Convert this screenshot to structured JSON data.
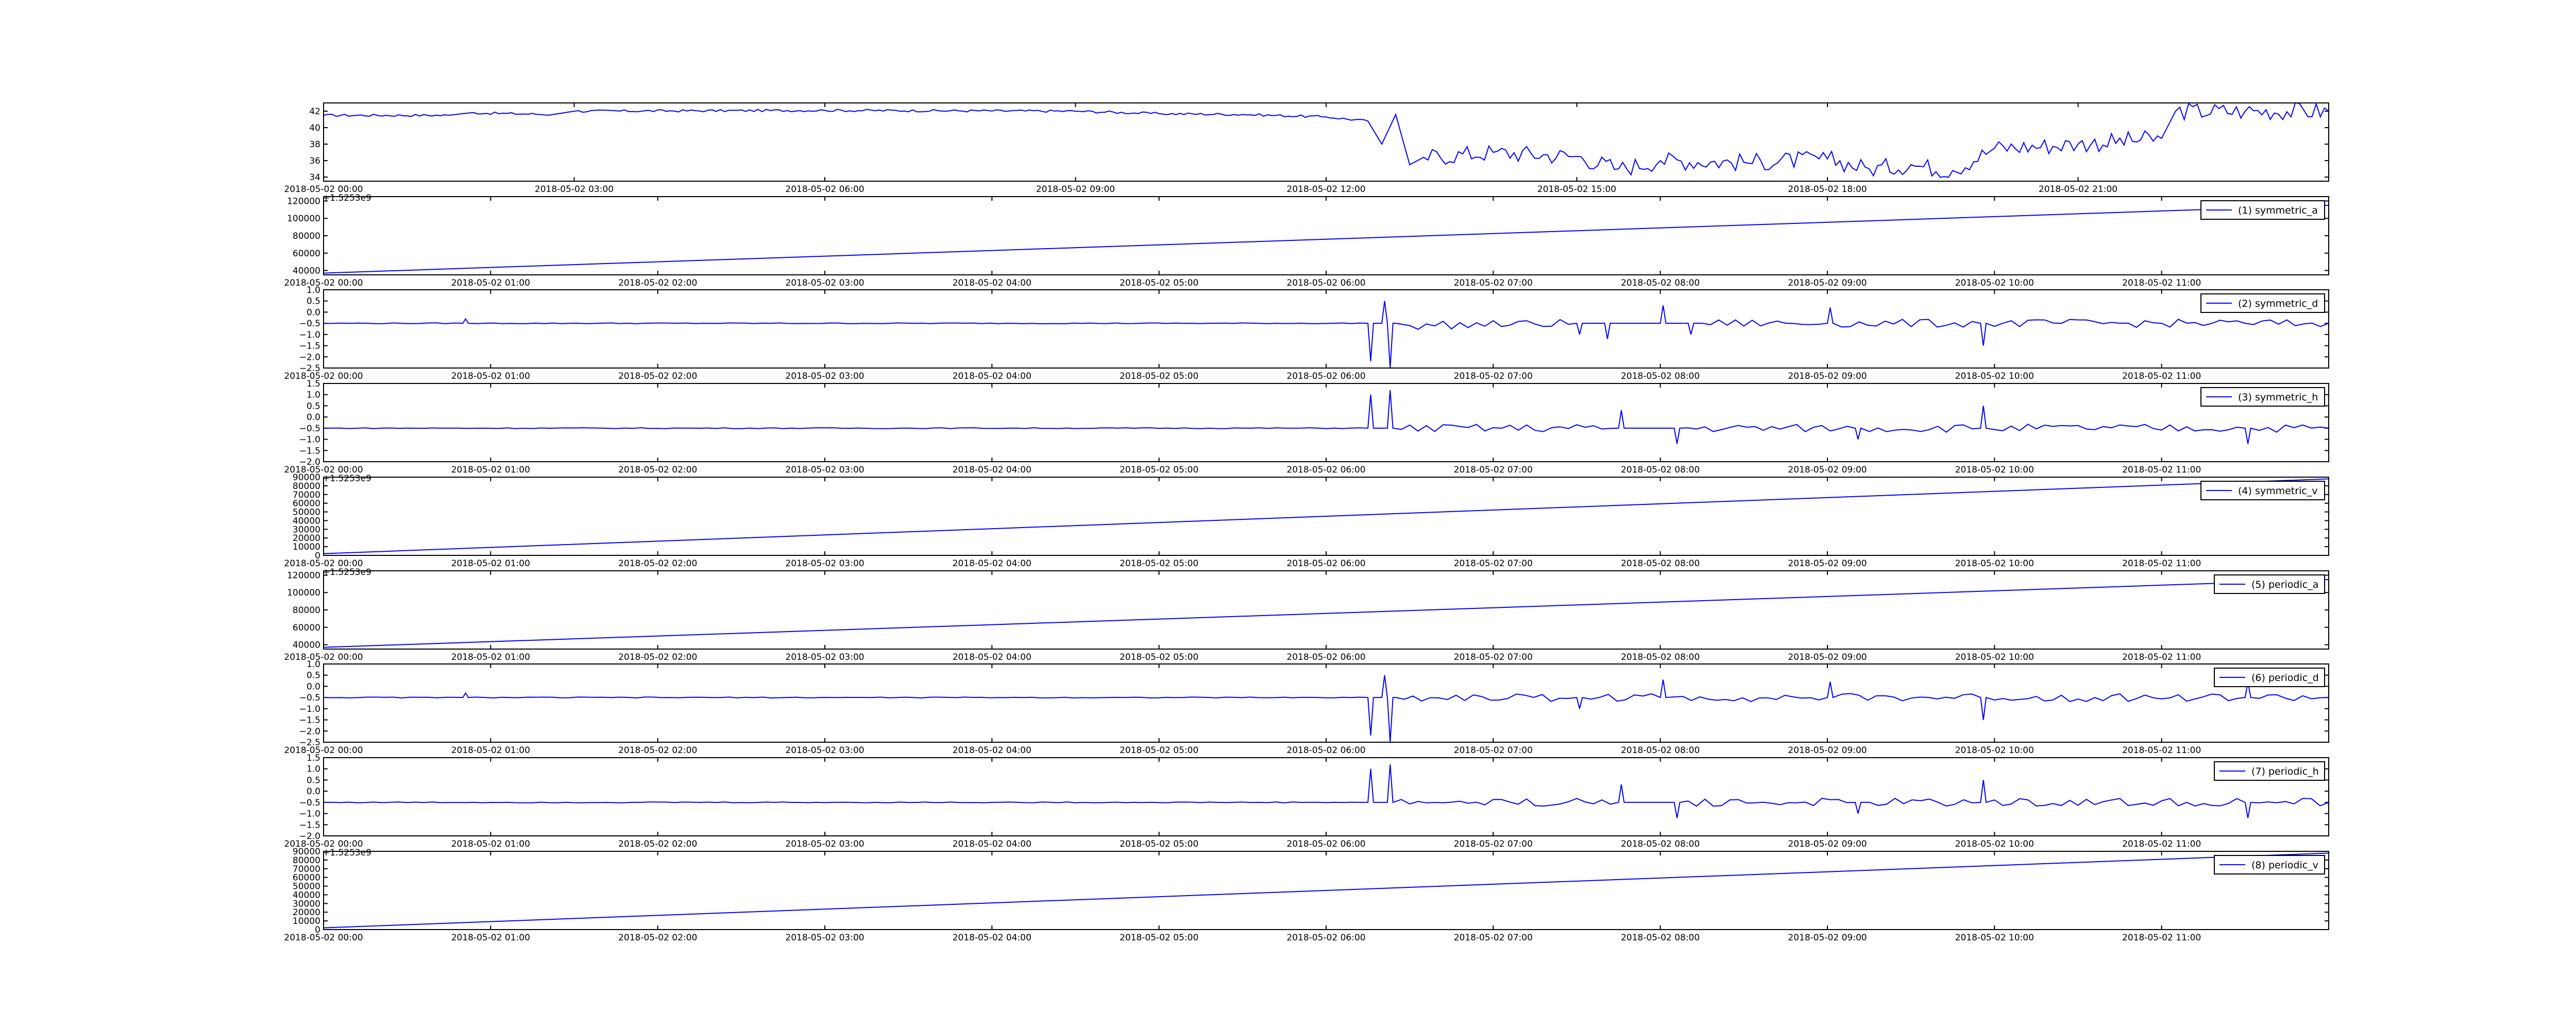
{
  "chart_data": [
    {
      "type": "line",
      "title": "",
      "ylim": [
        33.5,
        43
      ],
      "yticks": [
        34,
        36,
        38,
        40,
        42
      ],
      "yticklabels": [
        "34",
        "36",
        "38",
        "40",
        "42"
      ],
      "xlim": [
        "2018-05-02 00:00",
        "2018-05-03 00:00"
      ],
      "xticklabels": [
        "2018-05-02 00:00",
        "2018-05-02 03:00",
        "2018-05-02 06:00",
        "2018-05-02 09:00",
        "2018-05-02 12:00",
        "2018-05-02 15:00",
        "2018-05-02 18:00",
        "2018-05-02 21:00"
      ],
      "offset_text": "+1.5253e9",
      "series": [
        {
          "x": [
            "2018-05-02 00:00",
            "2018-05-02 01:30",
            "2018-05-02 01:45",
            "2018-05-02 02:45",
            "2018-05-02 03:00",
            "2018-05-02 06:00",
            "2018-05-02 09:00",
            "2018-05-02 10:00",
            "2018-05-02 11:00",
            "2018-05-02 12:00",
            "2018-05-02 12:30",
            "2018-05-02 12:40",
            "2018-05-02 12:50",
            "2018-05-02 13:00",
            "2018-05-02 13:10",
            "2018-05-02 14:00",
            "2018-05-02 15:00",
            "2018-05-02 15:30",
            "2018-05-02 16:00",
            "2018-05-02 17:00",
            "2018-05-02 18:00",
            "2018-05-02 18:30",
            "2018-05-02 19:00",
            "2018-05-02 19:30",
            "2018-05-02 20:00",
            "2018-05-02 21:00",
            "2018-05-02 22:00",
            "2018-05-02 22:10",
            "2018-05-02 23:00",
            "2018-05-03 00:00"
          ],
          "values": [
            41.5,
            41.5,
            41.8,
            41.6,
            42.0,
            42.1,
            42.0,
            41.7,
            41.6,
            41.3,
            40.8,
            38.0,
            41.6,
            35.5,
            36.4,
            37.0,
            36.5,
            35.0,
            36.0,
            35.8,
            36.2,
            35.0,
            35.5,
            34.8,
            37.5,
            38.0,
            38.7,
            42.0,
            42.0,
            42.0
          ]
        }
      ]
    },
    {
      "type": "line",
      "ylim": [
        35000,
        125000
      ],
      "yticks": [
        40000,
        60000,
        80000,
        100000,
        120000
      ],
      "yticklabels": [
        "40000",
        "60000",
        "80000",
        "100000",
        "120000"
      ],
      "xlim": [
        "2018-05-02 00:00",
        "2018-05-02 12:00"
      ],
      "xticklabels": [
        "2018-05-02 00:00",
        "2018-05-02 01:00",
        "2018-05-02 02:00",
        "2018-05-02 03:00",
        "2018-05-02 04:00",
        "2018-05-02 05:00",
        "2018-05-02 06:00",
        "2018-05-02 07:00",
        "2018-05-02 08:00",
        "2018-05-02 09:00",
        "2018-05-02 10:00",
        "2018-05-02 11:00"
      ],
      "offset_text": "",
      "series": [
        {
          "name": "(1) symmetric_a",
          "x": [
            "2018-05-02 00:00",
            "2018-05-02 12:00"
          ],
          "values": [
            37000,
            115000
          ]
        }
      ]
    },
    {
      "type": "line",
      "ylim": [
        -2.5,
        1.0
      ],
      "yticks": [
        -2.5,
        -2.0,
        -1.5,
        -1.0,
        -0.5,
        0.0,
        0.5,
        1.0
      ],
      "yticklabels": [
        "−2.5",
        "−2.0",
        "−1.5",
        "−1.0",
        "−0.5",
        "0.0",
        "0.5",
        "1.0"
      ],
      "xlim": [
        "2018-05-02 00:00",
        "2018-05-02 12:00"
      ],
      "xticklabels": [
        "2018-05-02 00:00",
        "2018-05-02 01:00",
        "2018-05-02 02:00",
        "2018-05-02 03:00",
        "2018-05-02 04:00",
        "2018-05-02 05:00",
        "2018-05-02 06:00",
        "2018-05-02 07:00",
        "2018-05-02 08:00",
        "2018-05-02 09:00",
        "2018-05-02 10:00",
        "2018-05-02 11:00"
      ],
      "offset_text": "",
      "baseline": -0.5,
      "series": [
        {
          "name": "(2) symmetric_d",
          "x": [
            "2018-05-02 00:00",
            "2018-05-02 00:50",
            "2018-05-02 00:51",
            "2018-05-02 00:52",
            "2018-05-02 06:15",
            "2018-05-02 06:16",
            "2018-05-02 06:17",
            "2018-05-02 06:20",
            "2018-05-02 06:21",
            "2018-05-02 06:22",
            "2018-05-02 06:23",
            "2018-05-02 06:24",
            "2018-05-02 06:25",
            "2018-05-02 06:30",
            "2018-05-02 07:30",
            "2018-05-02 07:31",
            "2018-05-02 07:32",
            "2018-05-02 07:40",
            "2018-05-02 07:41",
            "2018-05-02 07:42",
            "2018-05-02 08:00",
            "2018-05-02 08:01",
            "2018-05-02 08:02",
            "2018-05-02 08:10",
            "2018-05-02 08:11",
            "2018-05-02 08:12",
            "2018-05-02 09:00",
            "2018-05-02 09:01",
            "2018-05-02 09:02",
            "2018-05-02 09:55",
            "2018-05-02 09:56",
            "2018-05-02 09:57",
            "2018-05-02 11:30",
            "2018-05-02 12:00"
          ],
          "values": [
            -0.5,
            -0.5,
            -0.3,
            -0.5,
            -0.5,
            -2.2,
            -0.5,
            -0.5,
            0.5,
            -0.5,
            -2.5,
            -0.5,
            -0.5,
            -0.6,
            -0.5,
            -1.0,
            -0.5,
            -0.5,
            -1.2,
            -0.5,
            -0.5,
            0.3,
            -0.5,
            -0.5,
            -1.0,
            -0.5,
            -0.5,
            0.2,
            -0.5,
            -0.5,
            -1.5,
            -0.5,
            -0.5,
            -0.5
          ]
        }
      ]
    },
    {
      "type": "line",
      "ylim": [
        -2.0,
        1.5
      ],
      "yticks": [
        -2.0,
        -1.5,
        -1.0,
        -0.5,
        0.0,
        0.5,
        1.0,
        1.5
      ],
      "yticklabels": [
        "−2.0",
        "−1.5",
        "−1.0",
        "−0.5",
        "0.0",
        "0.5",
        "1.0",
        "1.5"
      ],
      "xlim": [
        "2018-05-02 00:00",
        "2018-05-02 12:00"
      ],
      "xticklabels": [
        "2018-05-02 00:00",
        "2018-05-02 01:00",
        "2018-05-02 02:00",
        "2018-05-02 03:00",
        "2018-05-02 04:00",
        "2018-05-02 05:00",
        "2018-05-02 06:00",
        "2018-05-02 07:00",
        "2018-05-02 08:00",
        "2018-05-02 09:00",
        "2018-05-02 10:00",
        "2018-05-02 11:00"
      ],
      "offset_text": "+1.5253e9",
      "baseline": -0.5,
      "series": [
        {
          "name": "(3) symmetric_h",
          "x": [
            "2018-05-02 00:00",
            "2018-05-02 06:15",
            "2018-05-02 06:16",
            "2018-05-02 06:17",
            "2018-05-02 06:22",
            "2018-05-02 06:23",
            "2018-05-02 06:24",
            "2018-05-02 07:45",
            "2018-05-02 07:46",
            "2018-05-02 07:47",
            "2018-05-02 08:05",
            "2018-05-02 08:06",
            "2018-05-02 08:07",
            "2018-05-02 09:10",
            "2018-05-02 09:11",
            "2018-05-02 09:12",
            "2018-05-02 09:55",
            "2018-05-02 09:56",
            "2018-05-02 09:57",
            "2018-05-02 11:30",
            "2018-05-02 11:31",
            "2018-05-02 11:32",
            "2018-05-02 12:00"
          ],
          "values": [
            -0.5,
            -0.5,
            1.0,
            -0.5,
            -0.5,
            1.2,
            -0.5,
            -0.5,
            0.3,
            -0.5,
            -0.5,
            -1.2,
            -0.5,
            -0.5,
            -1.0,
            -0.5,
            -0.5,
            0.5,
            -0.5,
            -0.5,
            -1.2,
            -0.5,
            -0.5
          ]
        }
      ]
    },
    {
      "type": "line",
      "ylim": [
        0,
        90000
      ],
      "yticks": [
        0,
        10000,
        20000,
        30000,
        40000,
        50000,
        60000,
        70000,
        80000,
        90000
      ],
      "yticklabels": [
        "0",
        "10000",
        "20000",
        "30000",
        "40000",
        "50000",
        "60000",
        "70000",
        "80000",
        "90000"
      ],
      "xlim": [
        "2018-05-02 00:00",
        "2018-05-02 12:00"
      ],
      "xticklabels": [
        "2018-05-02 00:00",
        "2018-05-02 01:00",
        "2018-05-02 02:00",
        "2018-05-02 03:00",
        "2018-05-02 04:00",
        "2018-05-02 05:00",
        "2018-05-02 06:00",
        "2018-05-02 07:00",
        "2018-05-02 08:00",
        "2018-05-02 09:00",
        "2018-05-02 10:00",
        "2018-05-02 11:00"
      ],
      "offset_text": "+1.5253e9",
      "series": [
        {
          "name": "(4) symmetric_v",
          "x": [
            "2018-05-02 00:00",
            "2018-05-02 12:00"
          ],
          "values": [
            2000,
            88000
          ]
        }
      ]
    },
    {
      "type": "line",
      "ylim": [
        35000,
        125000
      ],
      "yticks": [
        40000,
        60000,
        80000,
        100000,
        120000
      ],
      "yticklabels": [
        "40000",
        "60000",
        "80000",
        "100000",
        "120000"
      ],
      "xlim": [
        "2018-05-02 00:00",
        "2018-05-02 12:00"
      ],
      "xticklabels": [
        "2018-05-02 00:00",
        "2018-05-02 01:00",
        "2018-05-02 02:00",
        "2018-05-02 03:00",
        "2018-05-02 04:00",
        "2018-05-02 05:00",
        "2018-05-02 06:00",
        "2018-05-02 07:00",
        "2018-05-02 08:00",
        "2018-05-02 09:00",
        "2018-05-02 10:00",
        "2018-05-02 11:00"
      ],
      "offset_text": "",
      "series": [
        {
          "name": "(5) periodic_a",
          "x": [
            "2018-05-02 00:00",
            "2018-05-02 12:00"
          ],
          "values": [
            37000,
            115000
          ]
        }
      ]
    },
    {
      "type": "line",
      "ylim": [
        -2.5,
        1.0
      ],
      "yticks": [
        -2.5,
        -2.0,
        -1.5,
        -1.0,
        -0.5,
        0.0,
        0.5,
        1.0
      ],
      "yticklabels": [
        "−2.5",
        "−2.0",
        "−1.5",
        "−1.0",
        "−0.5",
        "0.0",
        "0.5",
        "1.0"
      ],
      "xlim": [
        "2018-05-02 00:00",
        "2018-05-02 12:00"
      ],
      "xticklabels": [
        "2018-05-02 00:00",
        "2018-05-02 01:00",
        "2018-05-02 02:00",
        "2018-05-02 03:00",
        "2018-05-02 04:00",
        "2018-05-02 05:00",
        "2018-05-02 06:00",
        "2018-05-02 07:00",
        "2018-05-02 08:00",
        "2018-05-02 09:00",
        "2018-05-02 10:00",
        "2018-05-02 11:00"
      ],
      "offset_text": "",
      "baseline": -0.5,
      "series": [
        {
          "name": "(6) periodic_d",
          "x": [
            "2018-05-02 00:00",
            "2018-05-02 00:50",
            "2018-05-02 00:51",
            "2018-05-02 00:52",
            "2018-05-02 06:15",
            "2018-05-02 06:16",
            "2018-05-02 06:17",
            "2018-05-02 06:20",
            "2018-05-02 06:21",
            "2018-05-02 06:22",
            "2018-05-02 06:23",
            "2018-05-02 06:24",
            "2018-05-02 06:25",
            "2018-05-02 07:30",
            "2018-05-02 07:31",
            "2018-05-02 07:32",
            "2018-05-02 08:00",
            "2018-05-02 08:01",
            "2018-05-02 08:02",
            "2018-05-02 09:00",
            "2018-05-02 09:01",
            "2018-05-02 09:02",
            "2018-05-02 09:55",
            "2018-05-02 09:56",
            "2018-05-02 09:57",
            "2018-05-02 11:30",
            "2018-05-02 11:31",
            "2018-05-02 11:32",
            "2018-05-02 12:00"
          ],
          "values": [
            -0.5,
            -0.5,
            -0.3,
            -0.5,
            -0.5,
            -2.2,
            -0.5,
            -0.5,
            0.5,
            -0.5,
            -2.5,
            -0.5,
            -0.5,
            -0.5,
            -1.0,
            -0.5,
            -0.5,
            0.3,
            -0.5,
            -0.5,
            0.2,
            -0.5,
            -0.5,
            -1.5,
            -0.5,
            -0.5,
            0.2,
            -0.5,
            -0.5
          ]
        }
      ]
    },
    {
      "type": "line",
      "ylim": [
        -2.0,
        1.5
      ],
      "yticks": [
        -2.0,
        -1.5,
        -1.0,
        -0.5,
        0.0,
        0.5,
        1.0,
        1.5
      ],
      "yticklabels": [
        "−2.0",
        "−1.5",
        "−1.0",
        "−0.5",
        "0.0",
        "0.5",
        "1.0",
        "1.5"
      ],
      "xlim": [
        "2018-05-02 00:00",
        "2018-05-02 12:00"
      ],
      "xticklabels": [
        "2018-05-02 00:00",
        "2018-05-02 01:00",
        "2018-05-02 02:00",
        "2018-05-02 03:00",
        "2018-05-02 04:00",
        "2018-05-02 05:00",
        "2018-05-02 06:00",
        "2018-05-02 07:00",
        "2018-05-02 08:00",
        "2018-05-02 09:00",
        "2018-05-02 10:00",
        "2018-05-02 11:00"
      ],
      "offset_text": "+1.5253e9",
      "baseline": -0.5,
      "series": [
        {
          "name": "(7) periodic_h",
          "x": [
            "2018-05-02 00:00",
            "2018-05-02 06:15",
            "2018-05-02 06:16",
            "2018-05-02 06:17",
            "2018-05-02 06:22",
            "2018-05-02 06:23",
            "2018-05-02 06:24",
            "2018-05-02 07:45",
            "2018-05-02 07:46",
            "2018-05-02 07:47",
            "2018-05-02 08:05",
            "2018-05-02 08:06",
            "2018-05-02 08:07",
            "2018-05-02 09:10",
            "2018-05-02 09:11",
            "2018-05-02 09:12",
            "2018-05-02 09:55",
            "2018-05-02 09:56",
            "2018-05-02 09:57",
            "2018-05-02 11:30",
            "2018-05-02 11:31",
            "2018-05-02 11:32",
            "2018-05-02 12:00"
          ],
          "values": [
            -0.5,
            -0.5,
            1.0,
            -0.5,
            -0.5,
            1.2,
            -0.5,
            -0.5,
            0.3,
            -0.5,
            -0.5,
            -1.2,
            -0.5,
            -0.5,
            -1.0,
            -0.5,
            -0.5,
            0.5,
            -0.5,
            -0.5,
            -1.2,
            -0.5,
            -0.5
          ]
        }
      ]
    },
    {
      "type": "line",
      "ylim": [
        0,
        90000
      ],
      "yticks": [
        0,
        10000,
        20000,
        30000,
        40000,
        50000,
        60000,
        70000,
        80000,
        90000
      ],
      "yticklabels": [
        "0",
        "10000",
        "20000",
        "30000",
        "40000",
        "50000",
        "60000",
        "70000",
        "80000",
        "90000"
      ],
      "xlim": [
        "2018-05-02 00:00",
        "2018-05-02 12:00"
      ],
      "xticklabels": [
        "2018-05-02 00:00",
        "2018-05-02 01:00",
        "2018-05-02 02:00",
        "2018-05-02 03:00",
        "2018-05-02 04:00",
        "2018-05-02 05:00",
        "2018-05-02 06:00",
        "2018-05-02 07:00",
        "2018-05-02 08:00",
        "2018-05-02 09:00",
        "2018-05-02 10:00",
        "2018-05-02 11:00"
      ],
      "offset_text": "",
      "series": [
        {
          "name": "(8) periodic_v",
          "x": [
            "2018-05-02 00:00",
            "2018-05-02 12:00"
          ],
          "values": [
            2000,
            88000
          ]
        }
      ]
    }
  ],
  "colors": {
    "line": "#0000ff",
    "axes": "#000000",
    "background": "#ffffff"
  }
}
